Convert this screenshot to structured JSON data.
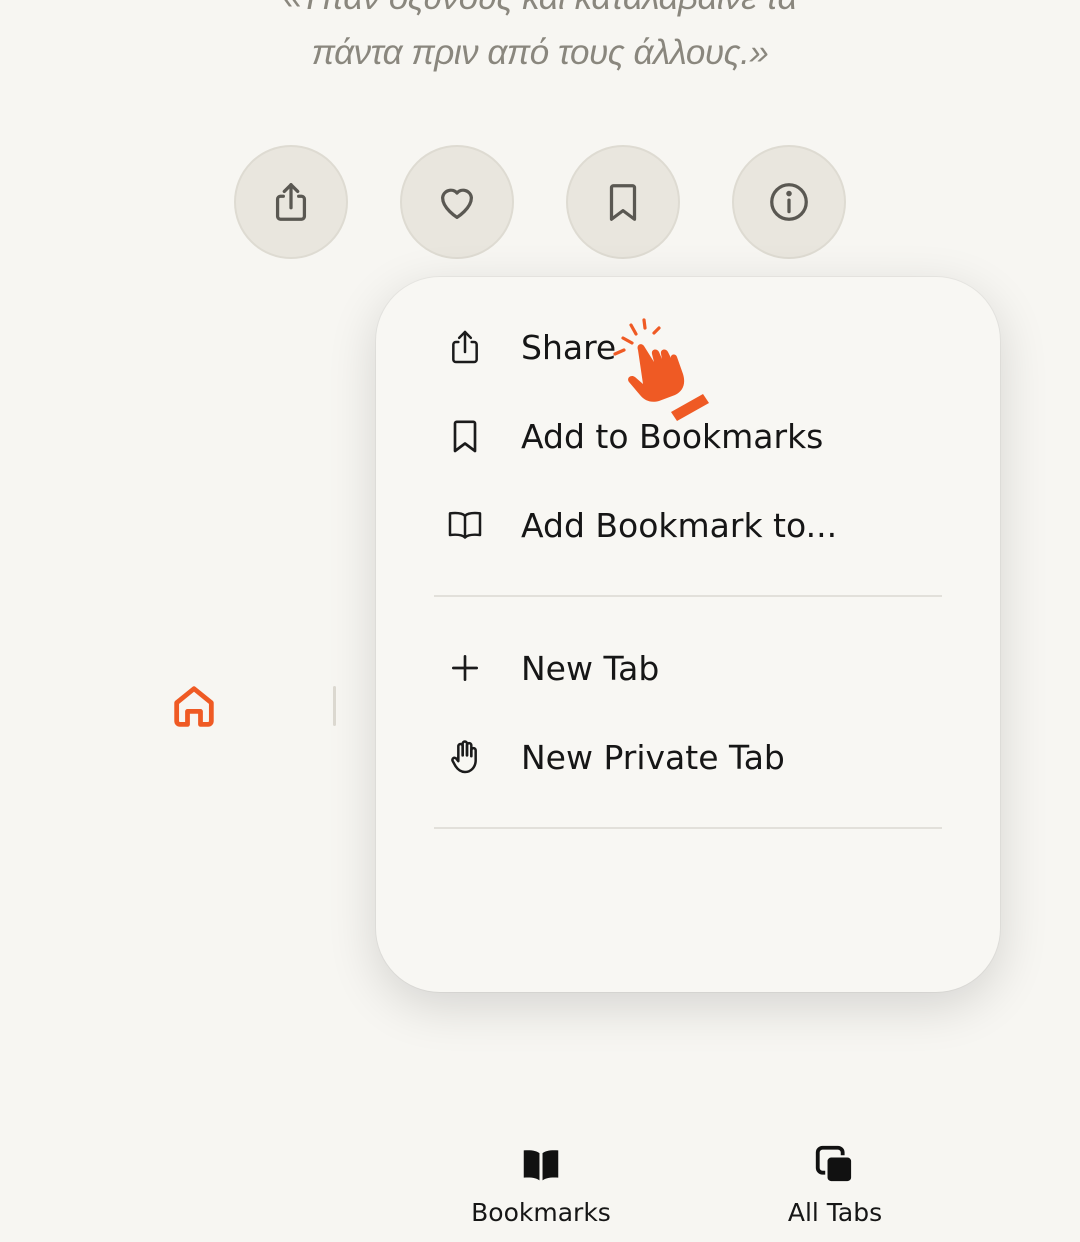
{
  "quote": {
    "line1": "«Ήταν οξύνους και κατάλαβαινε τα",
    "line2": "πάντα πριν από τους άλλους.»"
  },
  "actions": [
    {
      "name": "share",
      "icon": "share-icon"
    },
    {
      "name": "like",
      "icon": "heart-icon"
    },
    {
      "name": "bookmark",
      "icon": "bookmark-icon"
    },
    {
      "name": "info",
      "icon": "info-icon"
    }
  ],
  "menu": {
    "items": [
      {
        "label": "Share",
        "icon": "share-icon"
      },
      {
        "label": "Add to Bookmarks",
        "icon": "bookmark-icon"
      },
      {
        "label": "Add Bookmark to...",
        "icon": "open-book-icon"
      },
      {
        "label": "New Tab",
        "icon": "plus-icon"
      },
      {
        "label": "New Private Tab",
        "icon": "hand-icon"
      }
    ],
    "bottom": [
      {
        "label": "Bookmarks",
        "icon": "bookmarks-book-icon"
      },
      {
        "label": "All Tabs",
        "icon": "tabs-icon"
      }
    ]
  },
  "colors": {
    "background": "#f7f6f2",
    "accent": "#ef5a24",
    "button_bg": "#e9e6de",
    "icon": "#5a5852"
  }
}
